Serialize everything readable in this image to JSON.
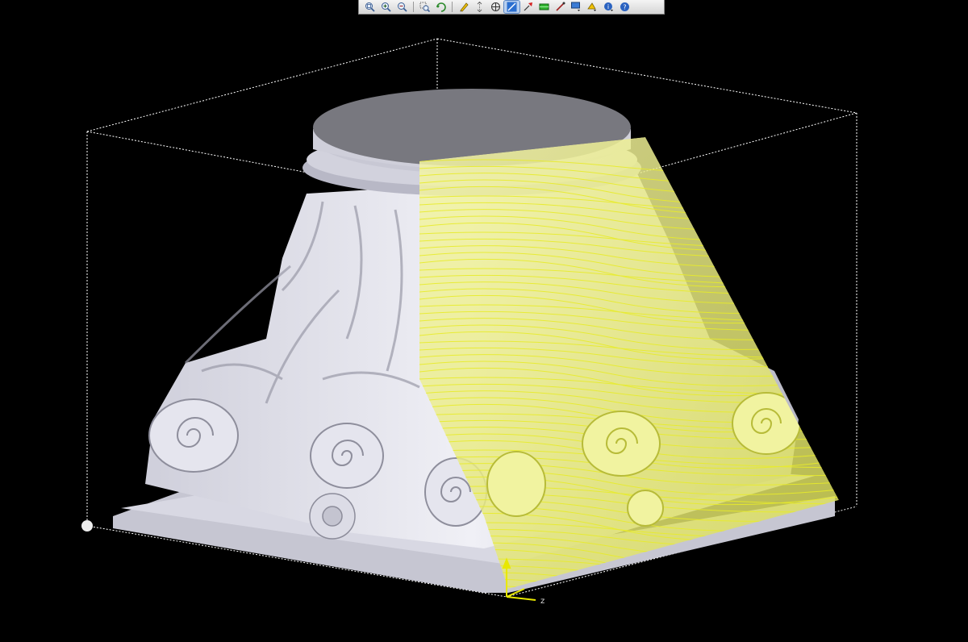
{
  "viewport": {
    "background": "#000000",
    "model_color": "#d9d9e4",
    "toolpath_color": "#ecf26a",
    "bbox_color": "#ffffff",
    "axis_color": "#e8e800",
    "axis_label": "z"
  },
  "toolbar": {
    "buttons": [
      {
        "name": "zoom-fit-icon",
        "active": false
      },
      {
        "name": "zoom-in-icon",
        "active": false
      },
      {
        "name": "zoom-out-icon",
        "active": false
      },
      {
        "sep": true
      },
      {
        "name": "zoom-box-icon",
        "active": false
      },
      {
        "name": "rotate-view-icon",
        "active": false
      },
      {
        "sep": true
      },
      {
        "name": "pencil-icon",
        "active": false
      },
      {
        "name": "measure-icon",
        "active": false
      },
      {
        "name": "target-icon",
        "active": false
      },
      {
        "name": "toolpath-view-icon",
        "active": true
      },
      {
        "name": "red-arrow-icon",
        "active": false
      },
      {
        "name": "green-plane-icon",
        "active": false
      },
      {
        "name": "probe-icon",
        "active": false
      },
      {
        "name": "display-dropdown-icon",
        "active": false
      },
      {
        "name": "shading-dropdown-icon",
        "active": false
      },
      {
        "name": "info-dropdown-icon",
        "active": false
      },
      {
        "name": "help-icon",
        "active": false
      }
    ]
  }
}
